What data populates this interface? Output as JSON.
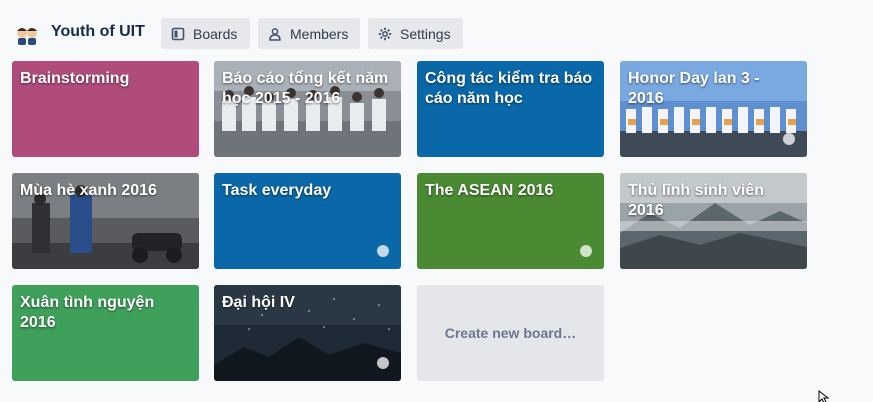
{
  "header": {
    "team_name": "Youth of UIT",
    "tabs": [
      {
        "label": "Boards",
        "icon": "board-icon"
      },
      {
        "label": "Members",
        "icon": "person-icon"
      },
      {
        "label": "Settings",
        "icon": "gear-icon"
      }
    ]
  },
  "boards": [
    {
      "title": "Brainstorming",
      "background": "#b04c7c",
      "starred": false
    },
    {
      "title": "Báo cáo tổng kết năm học 2015 - 2016",
      "background": "photo",
      "starred": false
    },
    {
      "title": "Công tác kiểm tra báo cáo năm học",
      "background": "#0a68a8",
      "starred": false
    },
    {
      "title": "Honor Day lan 3 - 2016",
      "background": "photo",
      "starred": true
    },
    {
      "title": "Mùa hè xanh 2016",
      "background": "photo",
      "starred": false
    },
    {
      "title": "Task everyday",
      "background": "#0a68a8",
      "starred": true
    },
    {
      "title": "The ASEAN 2016",
      "background": "#4a8a32",
      "starred": true
    },
    {
      "title": "Thủ lĩnh sinh viên 2016",
      "background": "photo",
      "starred": false
    },
    {
      "title": "Xuân tình nguyện 2016",
      "background": "#3ea05a",
      "starred": false
    },
    {
      "title": "Đại hội IV",
      "background": "photo",
      "starred": true
    }
  ],
  "create_board_label": "Create new board…",
  "colors": {
    "page_bg": "#f8f9fb",
    "tab_bg": "#e6e8ec",
    "create_tile_bg": "#e4e6ea"
  }
}
